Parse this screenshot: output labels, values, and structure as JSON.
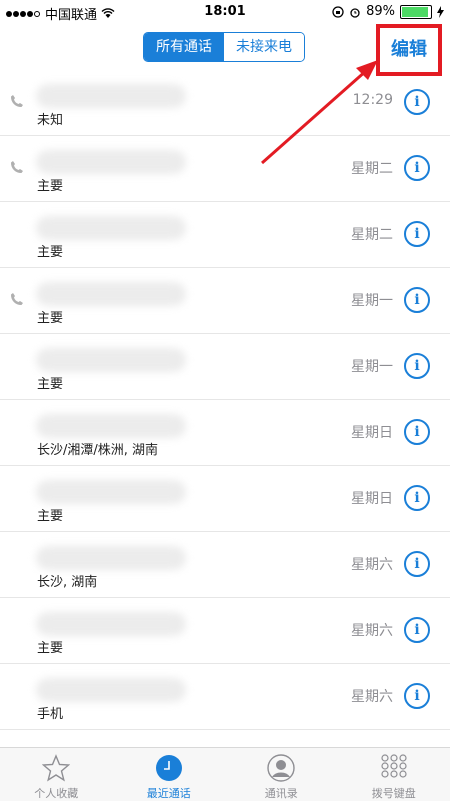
{
  "status": {
    "carrier": "中国联通",
    "time": "18:01",
    "battery": "89%"
  },
  "nav": {
    "tab_all": "所有通话",
    "tab_missed": "未接来电",
    "edit": "编辑"
  },
  "calls": [
    {
      "label": "未知",
      "date": "12:29"
    },
    {
      "label": "主要",
      "date": "星期二"
    },
    {
      "label": "主要",
      "date": "星期二"
    },
    {
      "label": "主要",
      "date": "星期一"
    },
    {
      "label": "主要",
      "date": "星期一"
    },
    {
      "label": "长沙/湘潭/株洲, 湖南",
      "date": "星期日"
    },
    {
      "label": "主要",
      "date": "星期日"
    },
    {
      "label": "长沙, 湖南",
      "date": "星期六"
    },
    {
      "label": "主要",
      "date": "星期六"
    },
    {
      "label": "手机",
      "date": "星期六"
    }
  ],
  "info_glyph": "i",
  "tabbar": {
    "favorites": "个人收藏",
    "recents": "最近通话",
    "contacts": "通讯录",
    "keypad": "拨号键盘"
  },
  "colors": {
    "accent": "#1a7fd8",
    "highlight": "#e31b23"
  }
}
